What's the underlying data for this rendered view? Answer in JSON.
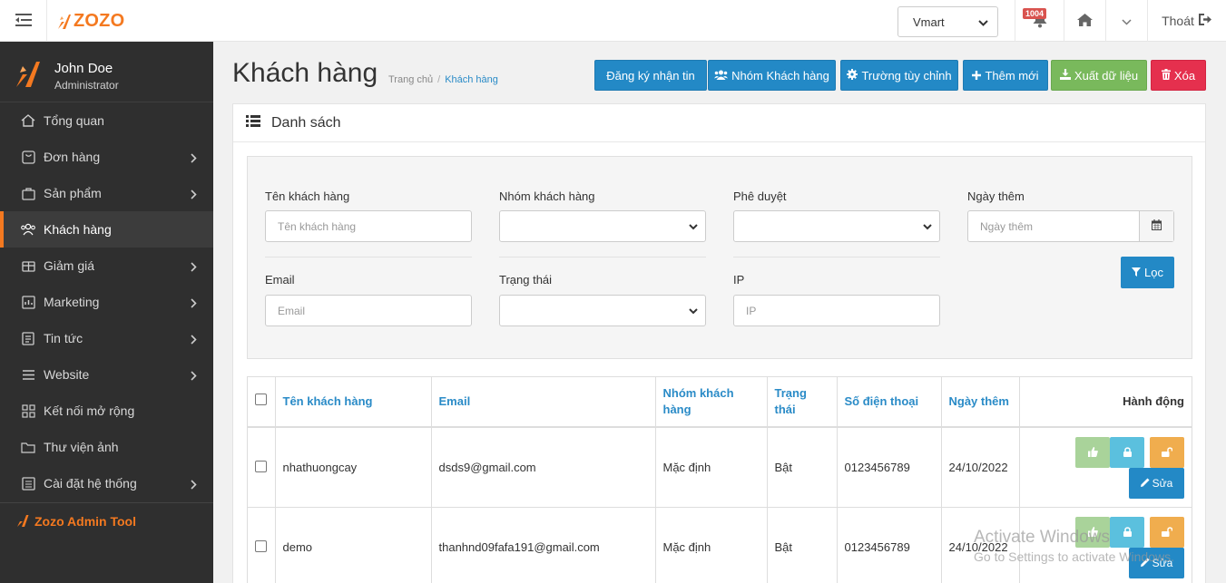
{
  "topbar": {
    "brand": "ZOZO",
    "store_select": "Vmart",
    "notification_count": "1004",
    "logout_label": "Thoát"
  },
  "sidebar": {
    "user_name": "John Doe",
    "user_role": "Administrator",
    "items": [
      {
        "label": "Tổng quan",
        "icon": "dashboard-icon",
        "has_children": false
      },
      {
        "label": "Đơn hàng",
        "icon": "order-icon",
        "has_children": true
      },
      {
        "label": "Sản phẩm",
        "icon": "product-icon",
        "has_children": true
      },
      {
        "label": "Khách hàng",
        "icon": "customers-icon",
        "has_children": false,
        "active": true
      },
      {
        "label": "Giảm giá",
        "icon": "discount-icon",
        "has_children": true
      },
      {
        "label": "Marketing",
        "icon": "marketing-icon",
        "has_children": true
      },
      {
        "label": "Tin tức",
        "icon": "news-icon",
        "has_children": true
      },
      {
        "label": "Website",
        "icon": "website-icon",
        "has_children": true
      },
      {
        "label": "Kết nối mở rộng",
        "icon": "extensions-icon",
        "has_children": false
      },
      {
        "label": "Thư viện ảnh",
        "icon": "gallery-icon",
        "has_children": false
      },
      {
        "label": "Cài đặt hệ thống",
        "icon": "settings-icon",
        "has_children": true
      }
    ],
    "footer_label": "Zozo Admin Tool"
  },
  "header": {
    "title": "Khách hàng",
    "breadcrumb": [
      "Trang chủ",
      "Khách hàng"
    ],
    "buttons": {
      "subscribe": "Đăng ký nhận tin",
      "customer_group": "Nhóm Khách hàng",
      "custom_fields": "Trường tùy chỉnh",
      "add_new": "Thêm mới",
      "export": "Xuất dữ liệu",
      "delete": "Xóa"
    }
  },
  "panel": {
    "title": "Danh sách",
    "filters": {
      "customer_name": {
        "label": "Tên khách hàng",
        "placeholder": "Tên khách hàng",
        "value": ""
      },
      "customer_group": {
        "label": "Nhóm khách hàng",
        "value": ""
      },
      "approval": {
        "label": "Phê duyệt",
        "value": ""
      },
      "date_added": {
        "label": "Ngày thêm",
        "placeholder": "Ngày thêm",
        "value": ""
      },
      "email": {
        "label": "Email",
        "placeholder": "Email",
        "value": ""
      },
      "status": {
        "label": "Trạng thái",
        "value": ""
      },
      "ip": {
        "label": "IP",
        "placeholder": "IP",
        "value": ""
      },
      "filter_button": "Lọc"
    },
    "table": {
      "columns": [
        "Tên khách hàng",
        "Email",
        "Nhóm khách hàng",
        "Trạng thái",
        "Số điện thoại",
        "Ngày thêm",
        "Hành động"
      ],
      "rows": [
        {
          "name": "nhathuongcay",
          "email": "dsds9@gmail.com",
          "group": "Mặc định",
          "status": "Bật",
          "phone": "0123456789",
          "date": "24/10/2022",
          "edit_label": "Sửa"
        },
        {
          "name": "demo",
          "email": "thanhnd09fafa191@gmail.com",
          "group": "Mặc định",
          "status": "Bật",
          "phone": "0123456789",
          "date": "24/10/2022",
          "edit_label": "Sửa"
        }
      ]
    }
  },
  "watermark": {
    "line1": "Activate Windows",
    "line2": "Go to Settings to activate Windows."
  },
  "colors": {
    "accent": "#f47920",
    "primary": "#2389c6",
    "success": "#79b95c",
    "danger": "#e5304e",
    "sidebar_bg": "#2f2f2f"
  }
}
